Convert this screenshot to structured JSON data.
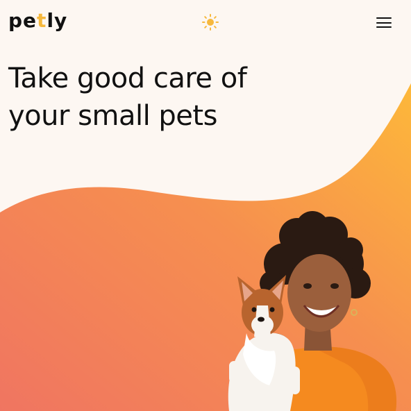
{
  "header": {
    "logo": {
      "before": "pe",
      "accent": "t",
      "after": "ly"
    },
    "theme_toggle_icon": "sun-icon",
    "menu_icon": "hamburger-menu-icon"
  },
  "hero": {
    "title_line1": "Take good care of",
    "title_line2": "your small pets",
    "image_icon": "woman-holding-puppy-photo"
  },
  "colors": {
    "background": "#fdf7f2",
    "accent": "#f6b83d",
    "gradient_start": "#f07a5c",
    "gradient_end": "#fbb33f",
    "text": "#111111"
  }
}
